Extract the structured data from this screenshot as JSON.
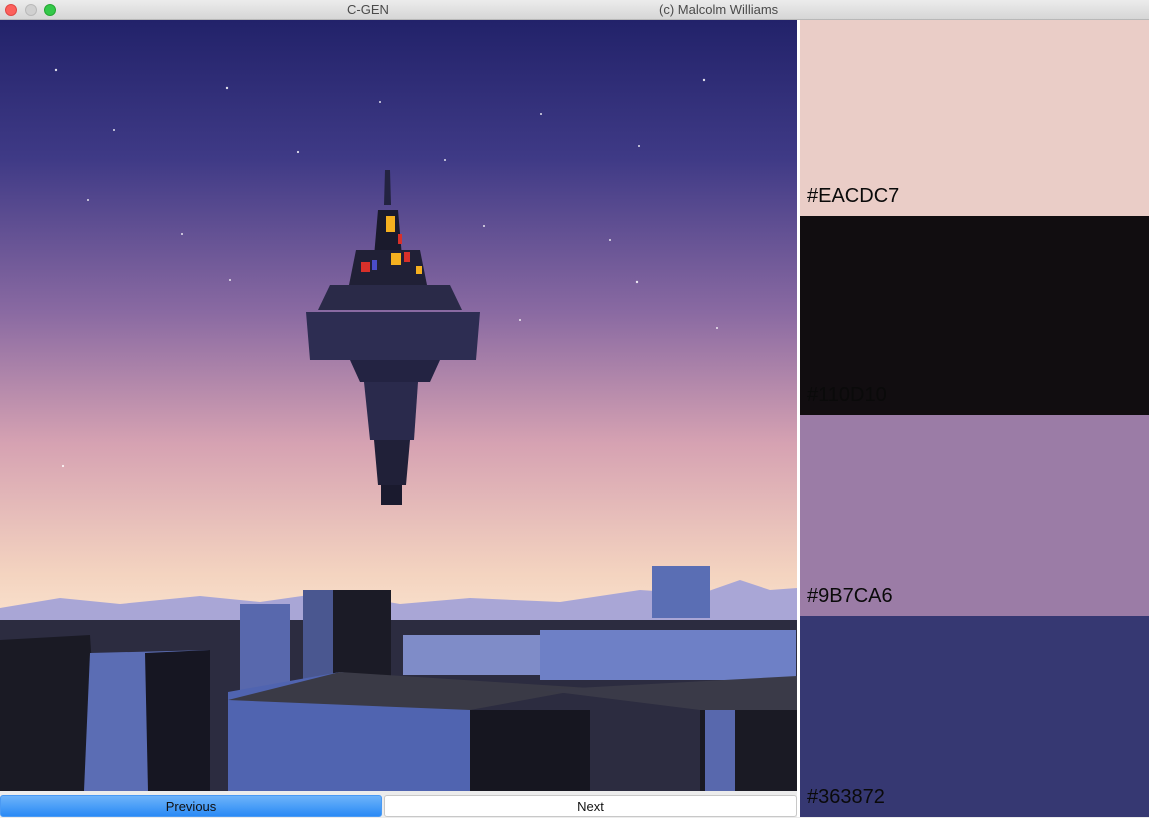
{
  "window": {
    "title": "C-GEN",
    "subtitle": "(c) Malcolm Williams"
  },
  "image": {
    "description_icon": "generated-art-image"
  },
  "palette": [
    {
      "label": "#EACDC7",
      "color": "#EACDC7"
    },
    {
      "label": "#110D10",
      "color": "#110D10"
    },
    {
      "label": "#9B7CA6",
      "color": "#9B7CA6"
    },
    {
      "label": "#363872",
      "color": "#363872"
    }
  ],
  "buttons": {
    "previous": "Previous",
    "next": "Next"
  }
}
